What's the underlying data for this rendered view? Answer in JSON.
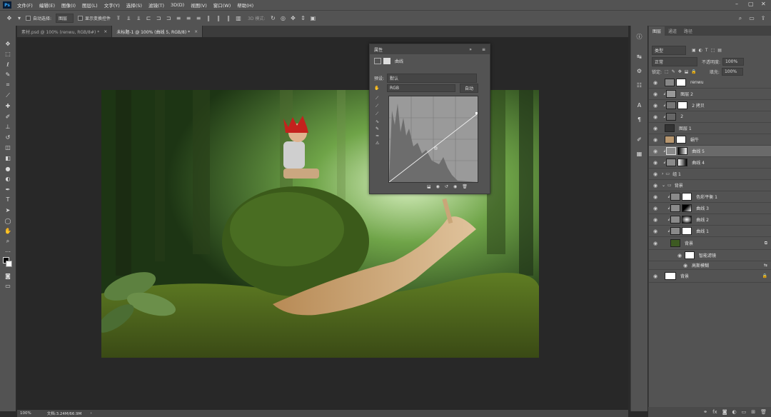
{
  "menubar": {
    "items": [
      "文件(F)",
      "编辑(E)",
      "图像(I)",
      "图层(L)",
      "文字(Y)",
      "选择(S)",
      "滤镜(T)",
      "3D(D)",
      "视图(V)",
      "窗口(W)",
      "帮助(H)"
    ],
    "logo": "Ps"
  },
  "options": {
    "auto_select_label": "自动选择:",
    "auto_select_value": "图层",
    "show_transform_label": "显示变换控件",
    "mode_3d": "3D 模式:"
  },
  "tabs": [
    {
      "label": "素材.psd @ 100% (renwu, RGB/8#) *",
      "active": false
    },
    {
      "label": "未标题-1 @ 100% (曲线 5, RGB/8) *",
      "active": true
    }
  ],
  "status": {
    "zoom": "100%",
    "doc": "文档:3.24M/66.9M"
  },
  "properties": {
    "tab": "属性",
    "title": "曲线",
    "preset_label": "预设:",
    "preset_value": "默认",
    "channel_value": "RGB",
    "auto_label": "自动"
  },
  "layers_panel": {
    "tabs": [
      "图层",
      "通道",
      "路径"
    ],
    "kind_label": "类型",
    "blend_mode": "正常",
    "opacity_label": "不透明度:",
    "opacity_value": "100%",
    "lock_label": "锁定:",
    "fill_label": "填充:",
    "fill_value": "100%",
    "layers": [
      {
        "name": "renwu"
      },
      {
        "name": "图层 2"
      },
      {
        "name": "2 拷贝"
      },
      {
        "name": "2"
      },
      {
        "name": "图层 1"
      },
      {
        "name": "蜗牛"
      },
      {
        "name": "曲线 5"
      },
      {
        "name": "曲线 4"
      },
      {
        "name": "组 1"
      },
      {
        "name": "背景"
      },
      {
        "name": "色彩平衡 1"
      },
      {
        "name": "曲线 3"
      },
      {
        "name": "曲线 2"
      },
      {
        "name": "曲线 1"
      },
      {
        "name": "背景"
      },
      {
        "name": "智能滤镜"
      },
      {
        "name": "高斯模糊"
      },
      {
        "name": "背景"
      }
    ]
  },
  "colors": {
    "accent": "#31a8ff",
    "panel": "#535353",
    "canvas_bg": "#282828"
  }
}
